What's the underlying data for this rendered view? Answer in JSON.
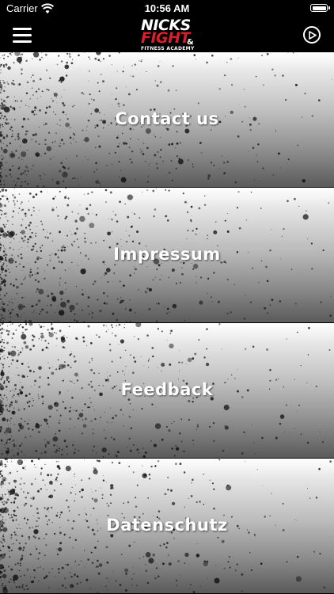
{
  "status_bar": {
    "carrier": "Carrier",
    "time": "10:56 AM"
  },
  "nav": {
    "logo": {
      "line1": "NICKS",
      "line2": "FIGHT",
      "amp": "&",
      "line3": "FITNESS ACADEMY"
    }
  },
  "tiles": [
    {
      "label": "Contact us"
    },
    {
      "label": "Impressum"
    },
    {
      "label": "Feedback"
    },
    {
      "label": "Datenschutz"
    }
  ]
}
